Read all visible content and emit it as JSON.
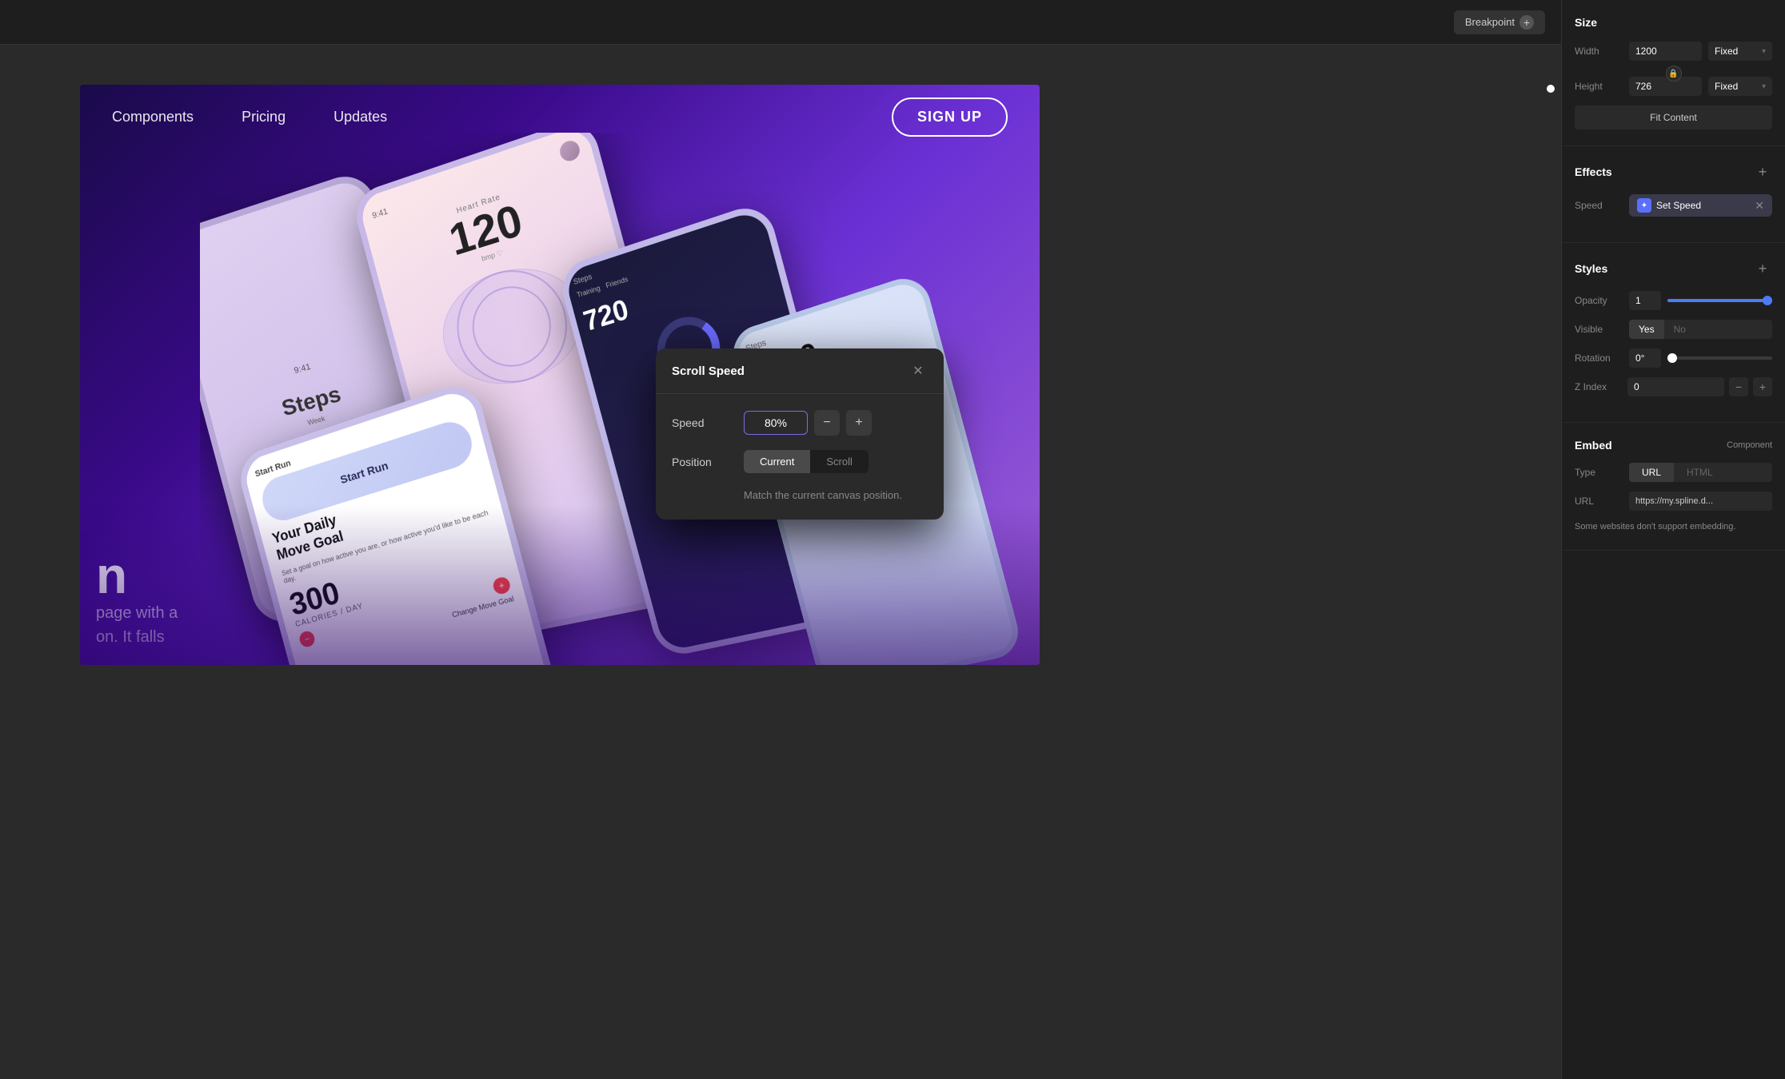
{
  "toolbar": {
    "breakpoint_label": "Breakpoint",
    "breakpoint_plus": "+"
  },
  "nav": {
    "links": [
      "Components",
      "Pricing",
      "Updates"
    ],
    "cta": "SIGN UP"
  },
  "hero": {
    "text_partial": "n",
    "subtext_line1": "page with a",
    "subtext_line2": "on. It falls"
  },
  "dialog": {
    "title": "Scroll Speed",
    "speed_label": "Speed",
    "speed_value": "80%",
    "position_label": "Position",
    "position_current": "Current",
    "position_scroll": "Scroll",
    "hint": "Match the current canvas position."
  },
  "right_panel": {
    "size": {
      "section_title": "Size",
      "width_label": "Width",
      "width_value": "1200",
      "width_mode": "Fixed",
      "height_label": "Height",
      "height_value": "726",
      "height_mode": "Fixed",
      "fit_content": "Fit Content"
    },
    "effects": {
      "section_title": "Effects",
      "speed_label": "Speed",
      "speed_badge_text": "Set Speed",
      "speed_badge_icon": "✦"
    },
    "styles": {
      "section_title": "Styles",
      "opacity_label": "Opacity",
      "opacity_value": "1",
      "visible_label": "Visible",
      "visible_yes": "Yes",
      "visible_no": "No",
      "rotation_label": "Rotation",
      "rotation_value": "0°",
      "z_index_label": "Z Index",
      "z_index_value": "0"
    },
    "embed": {
      "section_title": "Embed",
      "badge": "Component",
      "type_label": "Type",
      "type_url": "URL",
      "type_html": "HTML",
      "url_label": "URL",
      "url_value": "https://my.spline.d...",
      "warning": "Some websites don't support embedding."
    }
  }
}
